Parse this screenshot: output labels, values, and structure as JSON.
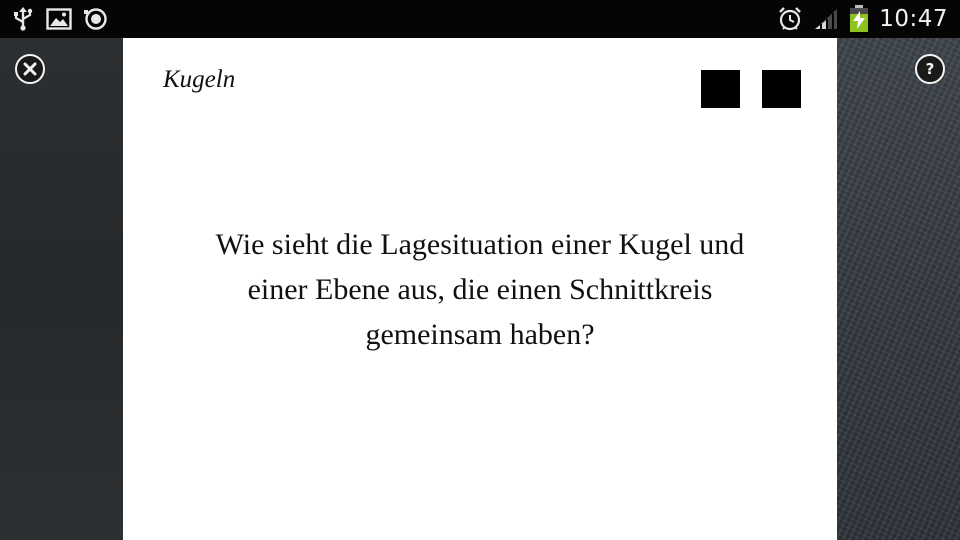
{
  "status_bar": {
    "clock": "10:47",
    "left_icons": [
      "usb-icon",
      "image-icon",
      "media-icon"
    ],
    "right_icons": [
      "alarm-clock-icon",
      "signal-icon",
      "battery-charging-icon"
    ],
    "battery_color": "#8ec21f"
  },
  "controls": {
    "close_icon": "close-icon",
    "help_glyph": "?"
  },
  "card": {
    "topic": "Kugeln",
    "question_lines": [
      "Wie sieht die Lagesituation einer Kugel und",
      "einer Ebene aus, die einen Schnittkreis",
      "gemeinsam haben?"
    ]
  }
}
